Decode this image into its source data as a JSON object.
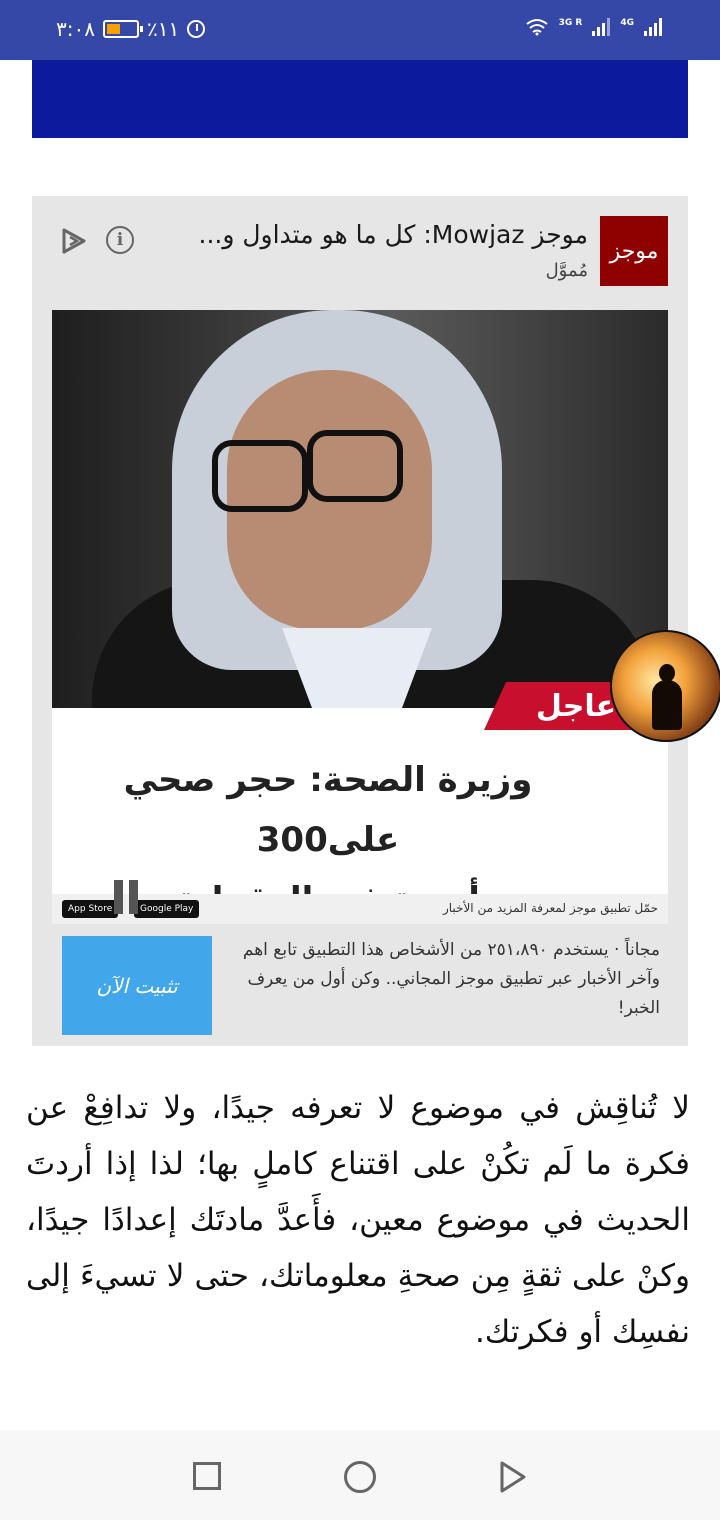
{
  "status_bar": {
    "time": "٣:٠٨",
    "battery_percent": "٪١١",
    "network_1": "3G R",
    "network_2": "4G"
  },
  "ad": {
    "logo_text": "موجز",
    "title": "موجز Mowjaz: كل ما هو متداول و...",
    "sponsored_label": "مُموَّل",
    "image": {
      "breaking_label": "عاجل",
      "headline_line1": "وزيرة الصحة: حجر صحي على300",
      "headline_line2": "أسرة في الدقهلية",
      "strip_text": "حمّل تطبيق موجز لمعرفة المزيد من الأخبار",
      "badge_app_store": "App Store",
      "badge_google_play": "Google Play"
    },
    "description": "مجاناً · يستخدم ٢٥١،٨٩٠ من الأشخاص هذا التطبيق تابع اهم وآخر الأخبار عبر تطبيق موجز المجاني.. وكن أول من يعرف الخبر!",
    "install_button": "تثبيت الآن"
  },
  "article": {
    "text": "لا تُناقِش في موضوع لا تعرفه جيدًا، ولا تدافِعْ عن فكرة ما لَم تكُنْ على اقتناع كاملٍ بها؛ لذا إذا أردتَ الحديث في موضوع معين، فأَعدَّ مادتَك إعدادًا جيدًا، وكنْ على ثقةٍ مِن صحةِ معلوماتك، حتى لا تسيءَ إلى نفسِك أو فكرتك."
  }
}
